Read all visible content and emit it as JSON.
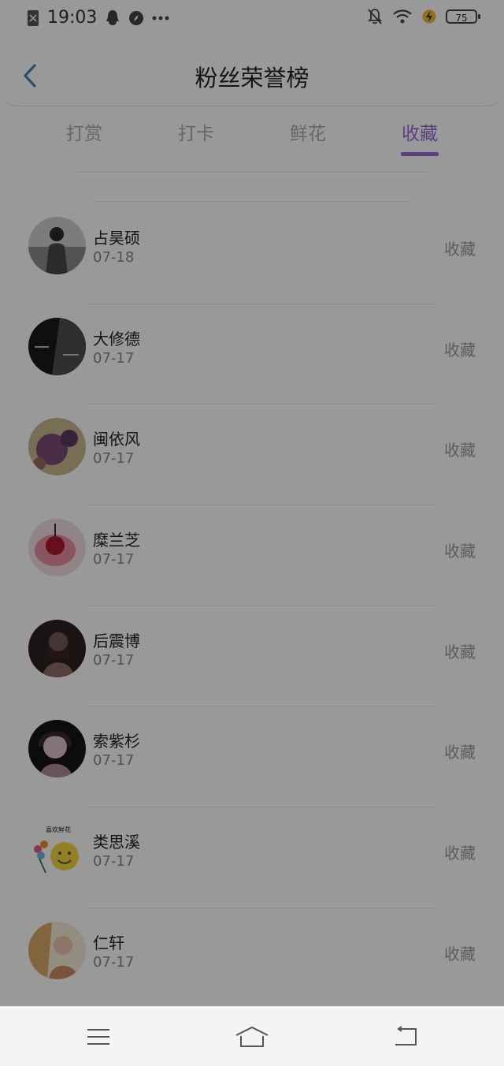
{
  "status_bar": {
    "time": "19:03",
    "icons": [
      "no-sim-icon",
      "qq-icon",
      "compass-icon",
      "more-dots-icon",
      "bell-muted-icon",
      "wifi-icon",
      "charging-icon",
      "battery-icon"
    ],
    "battery": "75"
  },
  "header": {
    "title": "粉丝荣誉榜",
    "back_icon": "chevron-left-icon"
  },
  "tabs": [
    {
      "label": "打赏",
      "active": false
    },
    {
      "label": "打卡",
      "active": false
    },
    {
      "label": "鲜花",
      "active": false
    },
    {
      "label": "收藏",
      "active": true
    }
  ],
  "colors": {
    "accent": "#9a66d8",
    "back": "#3c86c4"
  },
  "fans": [
    {
      "name": "占昊硕",
      "date": "07-18",
      "action": "收藏",
      "avatar_colors": [
        "#d8d8d8",
        "#5a5a5a"
      ]
    },
    {
      "name": "大修德",
      "date": "07-17",
      "action": "收藏",
      "avatar_colors": [
        "#1a1a1a",
        "#6f6f6f"
      ]
    },
    {
      "name": "闽依风",
      "date": "07-17",
      "action": "收藏",
      "avatar_colors": [
        "#7a4a78",
        "#c8b78e"
      ]
    },
    {
      "name": "糜兰芝",
      "date": "07-17",
      "action": "收藏",
      "avatar_colors": [
        "#f2dde4",
        "#c0304a"
      ]
    },
    {
      "name": "后震博",
      "date": "07-17",
      "action": "收藏",
      "avatar_colors": [
        "#2a2020",
        "#c7a39b"
      ]
    },
    {
      "name": "索紫杉",
      "date": "07-17",
      "action": "收藏",
      "avatar_colors": [
        "#151515",
        "#d9c2c8"
      ]
    },
    {
      "name": "类思溪",
      "date": "07-17",
      "action": "收藏",
      "avatar_text": "喜欢鲜花",
      "avatar_colors": [
        "#ffffff",
        "#f4d53c"
      ]
    },
    {
      "name": "仁轩",
      "date": "07-17",
      "action": "收藏",
      "avatar_colors": [
        "#d9a76a",
        "#f6ead5"
      ]
    }
  ],
  "nav_bar": {
    "icons": [
      "menu-icon",
      "home-icon",
      "back-icon"
    ]
  }
}
